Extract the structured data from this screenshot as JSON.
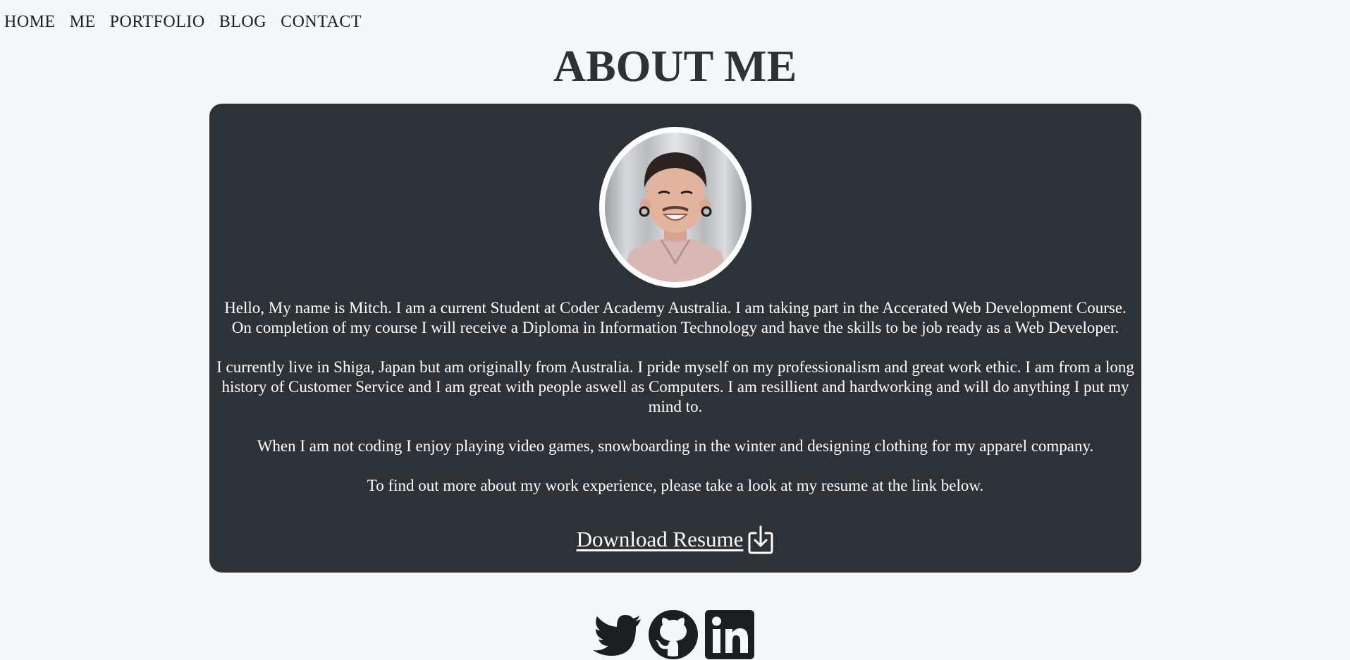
{
  "nav": {
    "items": [
      {
        "label": "HOME"
      },
      {
        "label": "ME"
      },
      {
        "label": "PORTFOLIO"
      },
      {
        "label": "BLOG"
      },
      {
        "label": "CONTACT"
      }
    ]
  },
  "page": {
    "title": "ABOUT ME"
  },
  "about": {
    "avatar_icon": "profile-photo",
    "paragraphs": [
      "Hello, My name is Mitch. I am a current Student at Coder Academy Australia. I am taking part in the Accerated Web Development Course. On completion of my course I will receive a Diploma in Information Technology and have the skills to be job ready as a Web Developer.",
      "I currently live in Shiga, Japan but am originally from Australia. I pride myself on my professionalism and great work ethic. I am from a long history of Customer Service and I am great with people aswell as Computers. I am resillient and hardworking and will do anything I put my mind to.",
      "When I am not coding I enjoy playing video games, snowboarding in the winter and designing clothing for my apparel company.",
      "To find out more about my work experience, please take a look at my resume at the link below."
    ],
    "download_label": "Download Resume",
    "download_icon": "download-icon"
  },
  "socials": {
    "icons": [
      "twitter-icon",
      "github-icon",
      "linkedin-icon"
    ]
  },
  "colors": {
    "background": "#f6f7f9",
    "card": "#2d3236",
    "text_dark": "#1b1f22",
    "text_light": "#ffffff"
  }
}
